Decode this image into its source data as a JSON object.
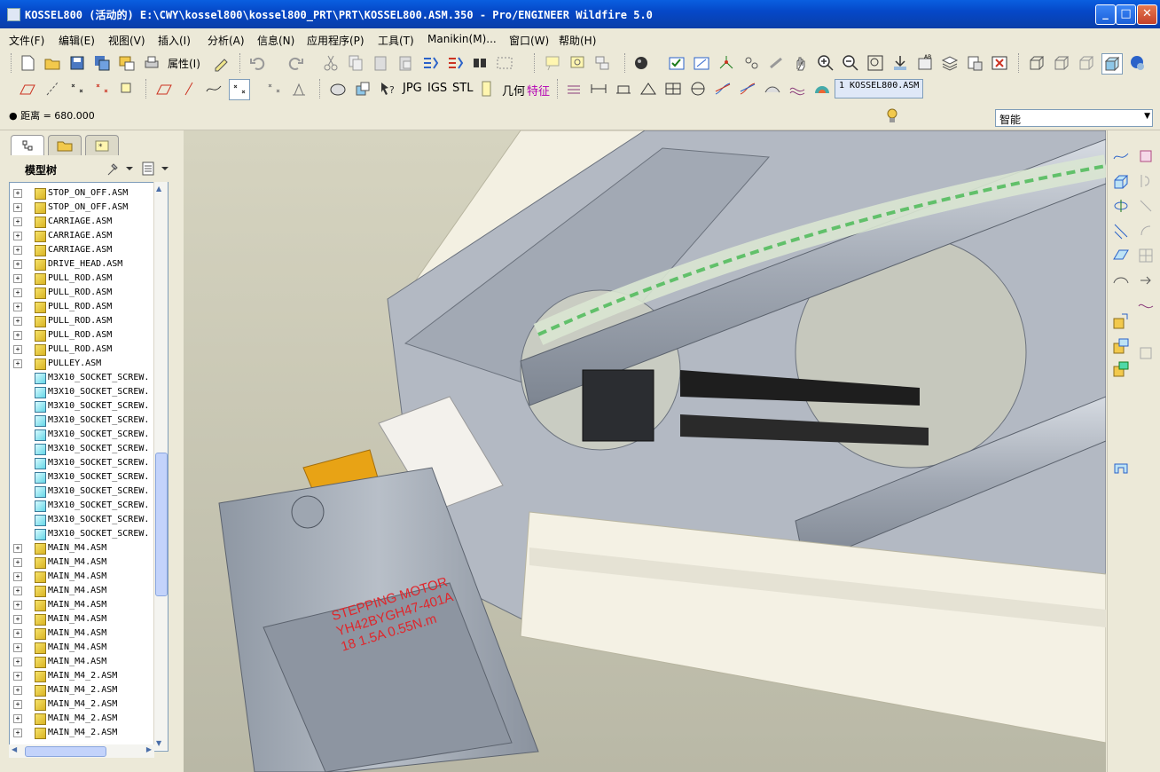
{
  "window": {
    "title": "KOSSEL800 (活动的) E:\\CWY\\kossel800\\kossel800_PRT\\PRT\\KOSSEL800.ASM.350 - Pro/ENGINEER Wildfire 5.0",
    "min_label": "_",
    "max_label": "□",
    "close_label": "✕"
  },
  "menu": [
    "文件(F)",
    "编辑(E)",
    "视图(V)",
    "插入(I)",
    "分析(A)",
    "信息(N)",
    "应用程序(P)",
    "工具(T)",
    "Manikin(M)...",
    "窗口(W)",
    "帮助(H)"
  ],
  "toolbar": {
    "properties_label": "属性(I)",
    "jpg": "JPG",
    "igs": "IGS",
    "stl": "STL",
    "geometry": "几何",
    "feature": "特征",
    "window_selector": "1 KOSSEL800.ASM"
  },
  "status": {
    "message": "● 距离 = 680.000",
    "filter_value": "智能"
  },
  "model_tree": {
    "title": "模型树",
    "items": [
      {
        "label": "STOP_ON_OFF.ASM",
        "type": "asm"
      },
      {
        "label": "STOP_ON_OFF.ASM",
        "type": "asm"
      },
      {
        "label": "CARRIAGE.ASM",
        "type": "asm"
      },
      {
        "label": "CARRIAGE.ASM",
        "type": "asm"
      },
      {
        "label": "CARRIAGE.ASM",
        "type": "asm"
      },
      {
        "label": "DRIVE_HEAD.ASM",
        "type": "asm"
      },
      {
        "label": "PULL_ROD.ASM",
        "type": "asm"
      },
      {
        "label": "PULL_ROD.ASM",
        "type": "asm"
      },
      {
        "label": "PULL_ROD.ASM",
        "type": "asm"
      },
      {
        "label": "PULL_ROD.ASM",
        "type": "asm"
      },
      {
        "label": "PULL_ROD.ASM",
        "type": "asm"
      },
      {
        "label": "PULL_ROD.ASM",
        "type": "asm"
      },
      {
        "label": "PULLEY.ASM",
        "type": "asm"
      },
      {
        "label": "M3X10_SOCKET_SCREW.",
        "type": "prt"
      },
      {
        "label": "M3X10_SOCKET_SCREW.",
        "type": "prt"
      },
      {
        "label": "M3X10_SOCKET_SCREW.",
        "type": "prt"
      },
      {
        "label": "M3X10_SOCKET_SCREW.",
        "type": "prt"
      },
      {
        "label": "M3X10_SOCKET_SCREW.",
        "type": "prt"
      },
      {
        "label": "M3X10_SOCKET_SCREW.",
        "type": "prt"
      },
      {
        "label": "M3X10_SOCKET_SCREW.",
        "type": "prt"
      },
      {
        "label": "M3X10_SOCKET_SCREW.",
        "type": "prt"
      },
      {
        "label": "M3X10_SOCKET_SCREW.",
        "type": "prt"
      },
      {
        "label": "M3X10_SOCKET_SCREW.",
        "type": "prt"
      },
      {
        "label": "M3X10_SOCKET_SCREW.",
        "type": "prt"
      },
      {
        "label": "M3X10_SOCKET_SCREW.",
        "type": "prt"
      },
      {
        "label": "MAIN_M4.ASM",
        "type": "asm"
      },
      {
        "label": "MAIN_M4.ASM",
        "type": "asm"
      },
      {
        "label": "MAIN_M4.ASM",
        "type": "asm"
      },
      {
        "label": "MAIN_M4.ASM",
        "type": "asm"
      },
      {
        "label": "MAIN_M4.ASM",
        "type": "asm"
      },
      {
        "label": "MAIN_M4.ASM",
        "type": "asm"
      },
      {
        "label": "MAIN_M4.ASM",
        "type": "asm"
      },
      {
        "label": "MAIN_M4.ASM",
        "type": "asm"
      },
      {
        "label": "MAIN_M4.ASM",
        "type": "asm"
      },
      {
        "label": "MAIN_M4_2.ASM",
        "type": "asm"
      },
      {
        "label": "MAIN_M4_2.ASM",
        "type": "asm"
      },
      {
        "label": "MAIN_M4_2.ASM",
        "type": "asm"
      },
      {
        "label": "MAIN_M4_2.ASM",
        "type": "asm"
      },
      {
        "label": "MAIN_M4_2.ASM",
        "type": "asm"
      }
    ]
  },
  "motor_label": [
    "STEPPING MOTOR",
    "YH42BYGH47-401A",
    "18 1.5A 0.55N.m"
  ],
  "colors": {
    "titlebar": "#0548c8",
    "chrome": "#ece9d8",
    "bracket": "#a9b0bc",
    "extrusion": "#f3f0e2",
    "label_red": "#e0262b",
    "tube_green": "#61c06a",
    "orange_part": "#e8a315"
  }
}
